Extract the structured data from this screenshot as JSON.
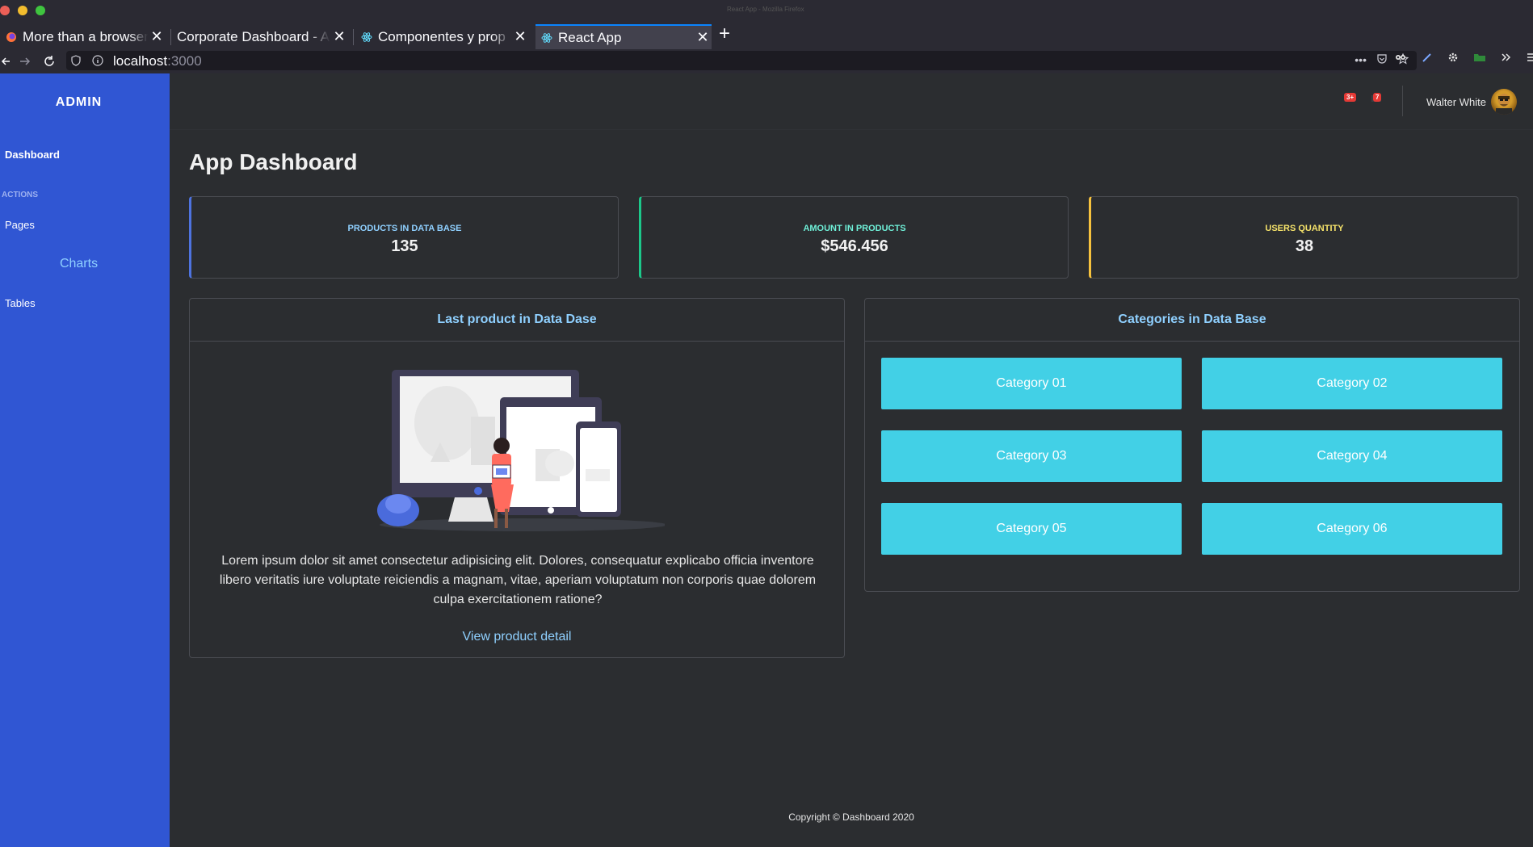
{
  "browser": {
    "window_title": "React App - Mozilla Firefox",
    "tabs": [
      {
        "label": "More than a browser",
        "active": false
      },
      {
        "label": "Corporate Dashboard - A",
        "active": false
      },
      {
        "label": "Componentes y prop",
        "active": false
      },
      {
        "label": "React App",
        "active": true
      }
    ],
    "close_glyph": "✕",
    "new_tab_glyph": "+",
    "url_host": "localhost",
    "url_port": ":3000"
  },
  "sidebar": {
    "brand": "ADMIN",
    "dashboard": "Dashboard",
    "actions_heading": "ACTIONS",
    "pages": "Pages",
    "charts": "Charts",
    "tables": "Tables"
  },
  "topbar": {
    "alerts_badge": "3+",
    "messages_badge": "7",
    "user_name": "Walter White"
  },
  "page": {
    "title": "App Dashboard"
  },
  "stats": [
    {
      "label": "PRODUCTS IN DATA BASE",
      "value": "135",
      "color": "#4e73df"
    },
    {
      "label": "AMOUNT IN PRODUCTS",
      "value": "$546.456",
      "color": "#1cc88a"
    },
    {
      "label": "USERS QUANTITY",
      "value": "38",
      "color": "#f6c23e"
    }
  ],
  "last_product": {
    "title": "Last product in Data Dase",
    "description": "Lorem ipsum dolor sit amet consectetur adipisicing elit. Dolores, consequatur explicabo officia inventore libero veritatis iure voluptate reiciendis a magnam, vitae, aperiam voluptatum non corporis quae dolorem culpa exercitationem ratione?",
    "link": "View product detail"
  },
  "categories": {
    "title": "Categories in Data Base",
    "items": [
      "Category 01",
      "Category 02",
      "Category 03",
      "Category 04",
      "Category 05",
      "Category 06"
    ]
  },
  "footer": {
    "copyright": "Copyright © Dashboard 2020"
  },
  "colors": {
    "sidebar": "#3056d3",
    "accent_link": "#8fd0ff",
    "category_button": "#42d0e6",
    "badge": "#e53935"
  }
}
